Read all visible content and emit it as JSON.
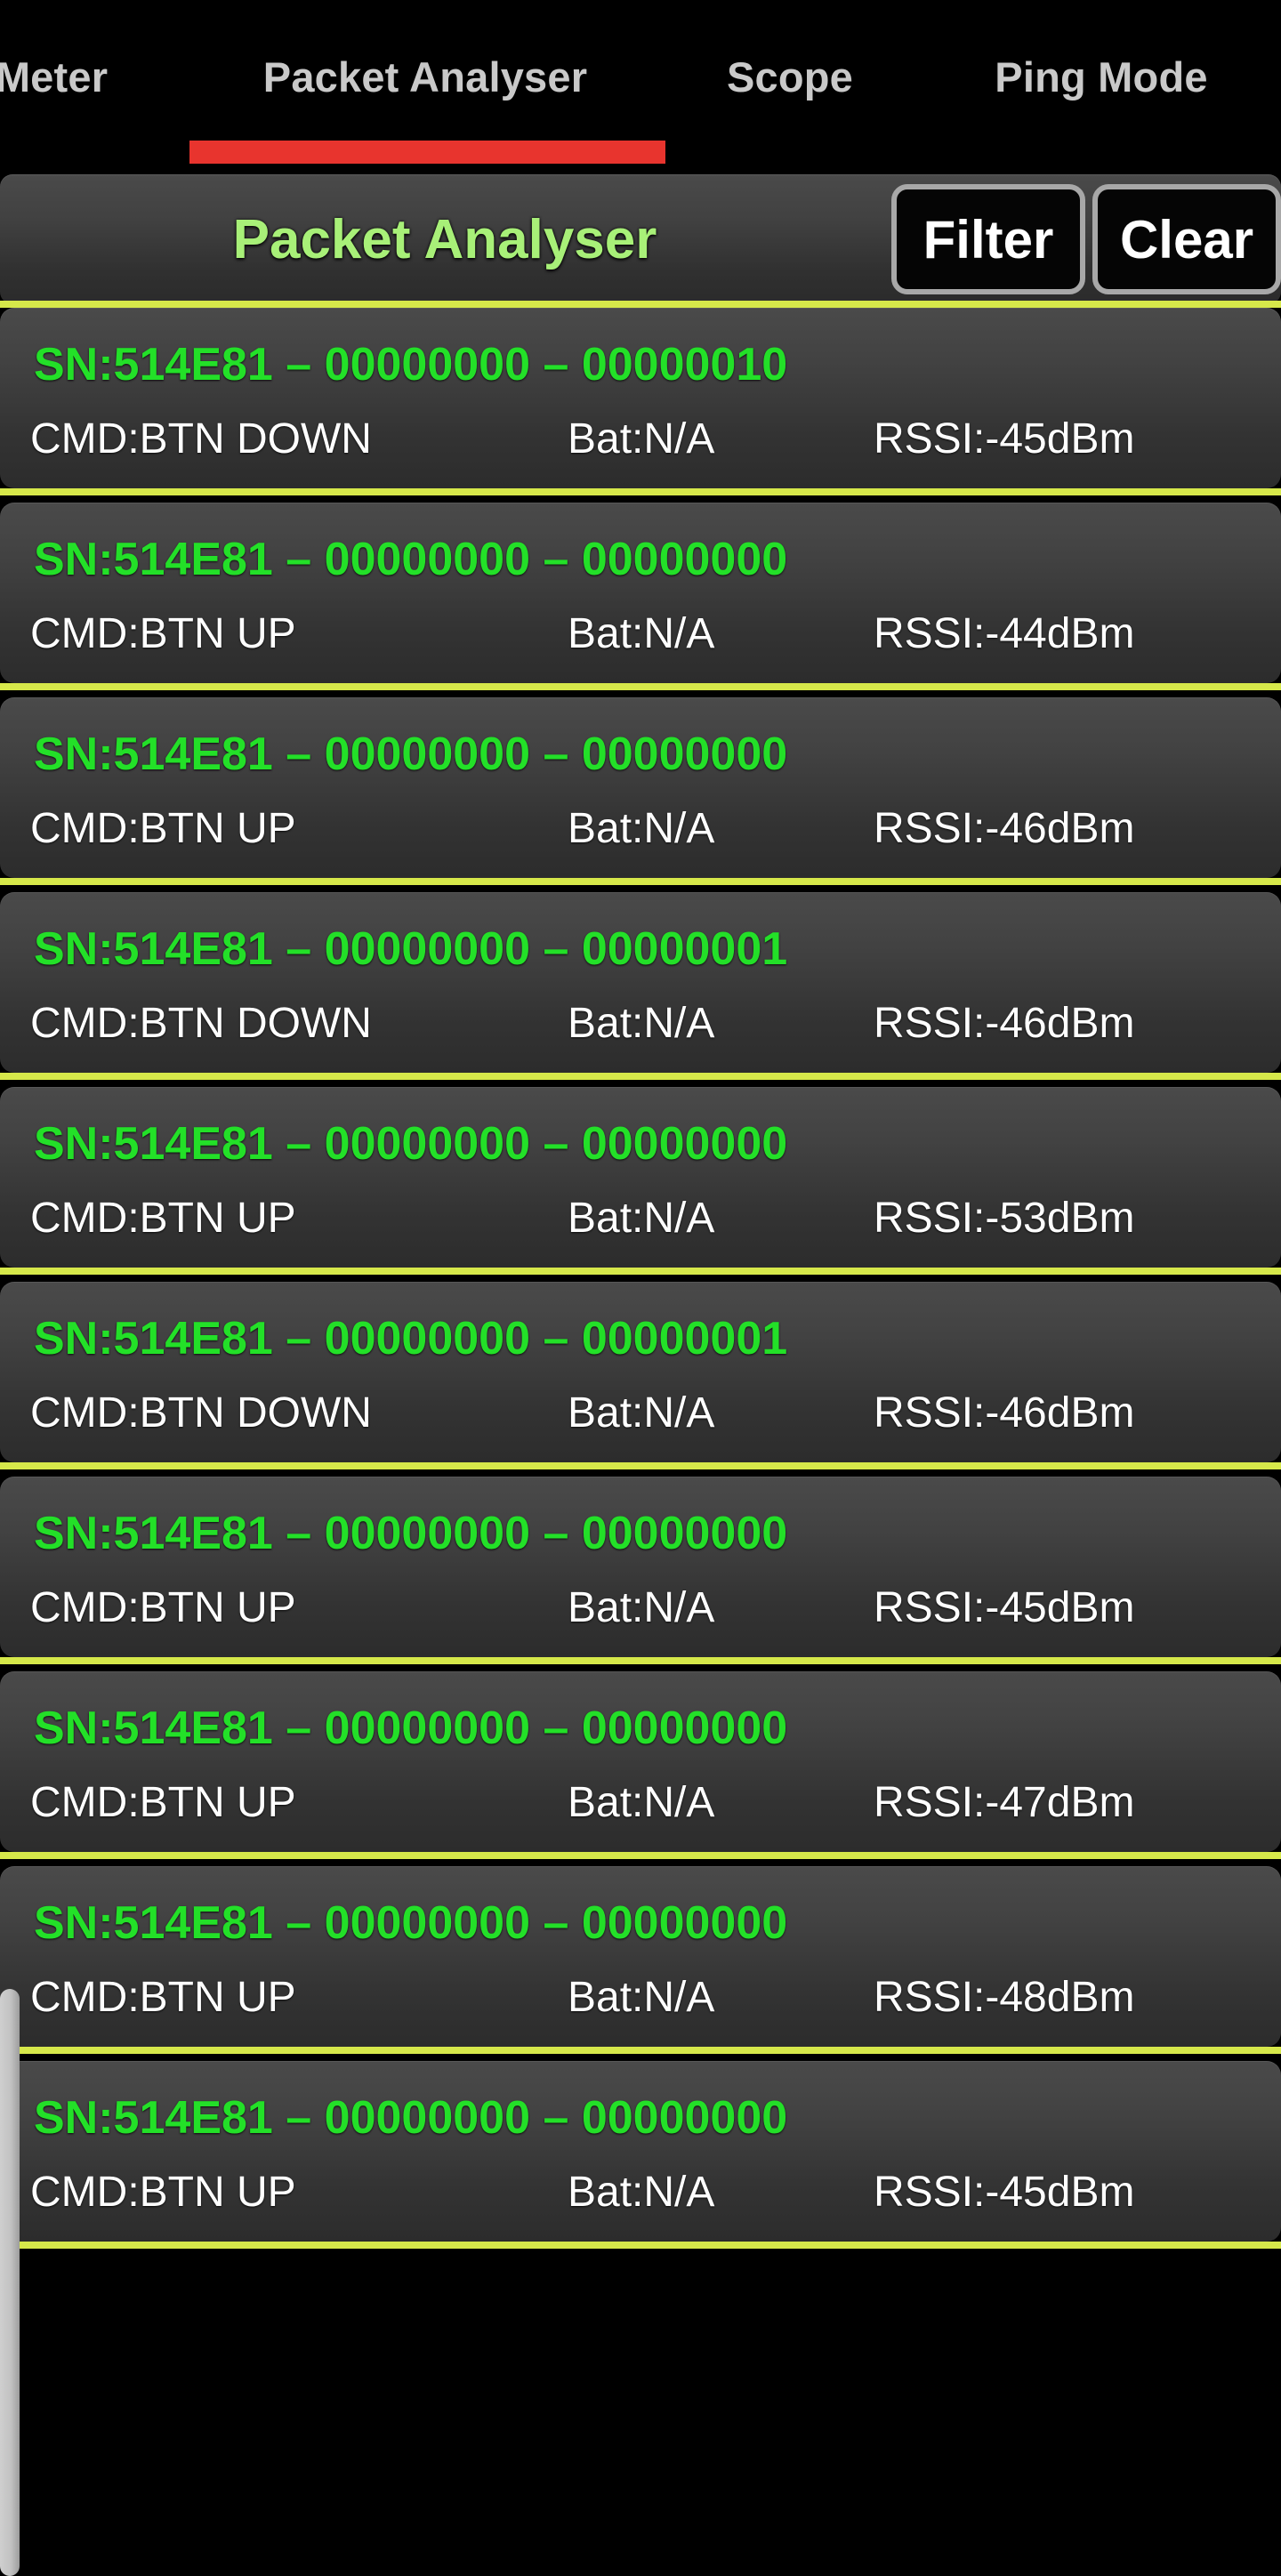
{
  "tabbar": {
    "tabs": [
      {
        "label": "Meter",
        "active": false
      },
      {
        "label": "Packet Analyser",
        "active": true
      },
      {
        "label": "Scope",
        "active": false
      },
      {
        "label": "Ping Mode",
        "active": false
      }
    ],
    "active_indicator_color": "#e8342e"
  },
  "header": {
    "title": "Packet Analyser",
    "title_color": "#a8f078",
    "filter_label": "Filter",
    "clear_label": "Clear"
  },
  "colors": {
    "divider": "#d6e84a",
    "sn_green": "#23e028",
    "card_bg": "#3a3a3a",
    "page_bg": "#000000",
    "scrollbar": "#c6c6c6"
  },
  "packets": [
    {
      "sn": "SN:514E81 – 00000000 – 00000010",
      "cmd": "CMD:BTN DOWN",
      "bat": "Bat:N/A",
      "rssi": "RSSI:-45dBm"
    },
    {
      "sn": "SN:514E81 – 00000000 – 00000000",
      "cmd": "CMD:BTN UP",
      "bat": "Bat:N/A",
      "rssi": "RSSI:-44dBm"
    },
    {
      "sn": "SN:514E81 – 00000000 – 00000000",
      "cmd": "CMD:BTN UP",
      "bat": "Bat:N/A",
      "rssi": "RSSI:-46dBm"
    },
    {
      "sn": "SN:514E81 – 00000000 – 00000001",
      "cmd": "CMD:BTN DOWN",
      "bat": "Bat:N/A",
      "rssi": "RSSI:-46dBm"
    },
    {
      "sn": "SN:514E81 – 00000000 – 00000000",
      "cmd": "CMD:BTN UP",
      "bat": "Bat:N/A",
      "rssi": "RSSI:-53dBm"
    },
    {
      "sn": "SN:514E81 – 00000000 – 00000001",
      "cmd": "CMD:BTN DOWN",
      "bat": "Bat:N/A",
      "rssi": "RSSI:-46dBm"
    },
    {
      "sn": "SN:514E81 – 00000000 – 00000000",
      "cmd": "CMD:BTN UP",
      "bat": "Bat:N/A",
      "rssi": "RSSI:-45dBm"
    },
    {
      "sn": "SN:514E81 – 00000000 – 00000000",
      "cmd": "CMD:BTN UP",
      "bat": "Bat:N/A",
      "rssi": "RSSI:-47dBm"
    },
    {
      "sn": "SN:514E81 – 00000000 – 00000000",
      "cmd": "CMD:BTN UP",
      "bat": "Bat:N/A",
      "rssi": "RSSI:-48dBm"
    },
    {
      "sn": "SN:514E81 – 00000000 – 00000000",
      "cmd": "CMD:BTN UP",
      "bat": "Bat:N/A",
      "rssi": "RSSI:-45dBm"
    }
  ]
}
